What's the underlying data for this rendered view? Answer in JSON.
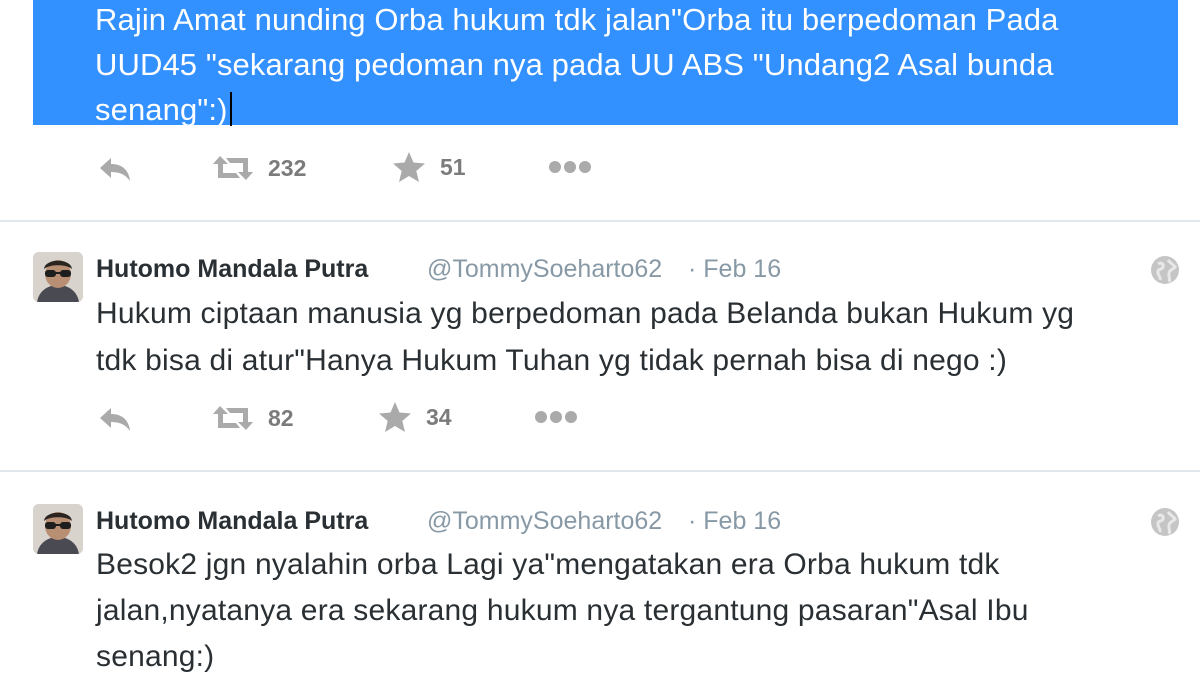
{
  "tweets": [
    {
      "lines": [
        "Rajin Amat nunding Orba hukum tdk jalan\"Orba itu berpedoman Pada",
        "UUD45 \"sekarang pedoman nya pada UU ABS \"Undang2 Asal bunda",
        "senang\":)"
      ],
      "retweets": "232",
      "favorites": "51"
    },
    {
      "name": "Hutomo Mandala Putra",
      "handle": "@TommySoeharto62",
      "date": "· Feb 16",
      "lines": [
        "Hukum ciptaan manusia yg berpedoman pada Belanda bukan Hukum yg",
        "tdk bisa di atur\"Hanya Hukum Tuhan yg tidak pernah bisa di nego :)"
      ],
      "retweets": "82",
      "favorites": "34"
    },
    {
      "name": "Hutomo Mandala Putra",
      "handle": "@TommySoeharto62",
      "date": "· Feb 16",
      "lines": [
        "Besok2 jgn nyalahin orba Lagi ya\"mengatakan era Orba hukum tdk",
        "jalan,nyatanya era sekarang hukum nya tergantung pasaran\"Asal Ibu",
        "senang:)"
      ]
    }
  ],
  "icons": {
    "reply": "reply-icon",
    "retweet": "retweet-icon",
    "favorite": "star-icon",
    "more": "more-icon",
    "globe": "globe-icon"
  },
  "colors": {
    "selection": "#3390ff",
    "icon_gray": "#a8a8a8",
    "handle_gray": "#8899a6",
    "divider": "#e1e8ed"
  }
}
